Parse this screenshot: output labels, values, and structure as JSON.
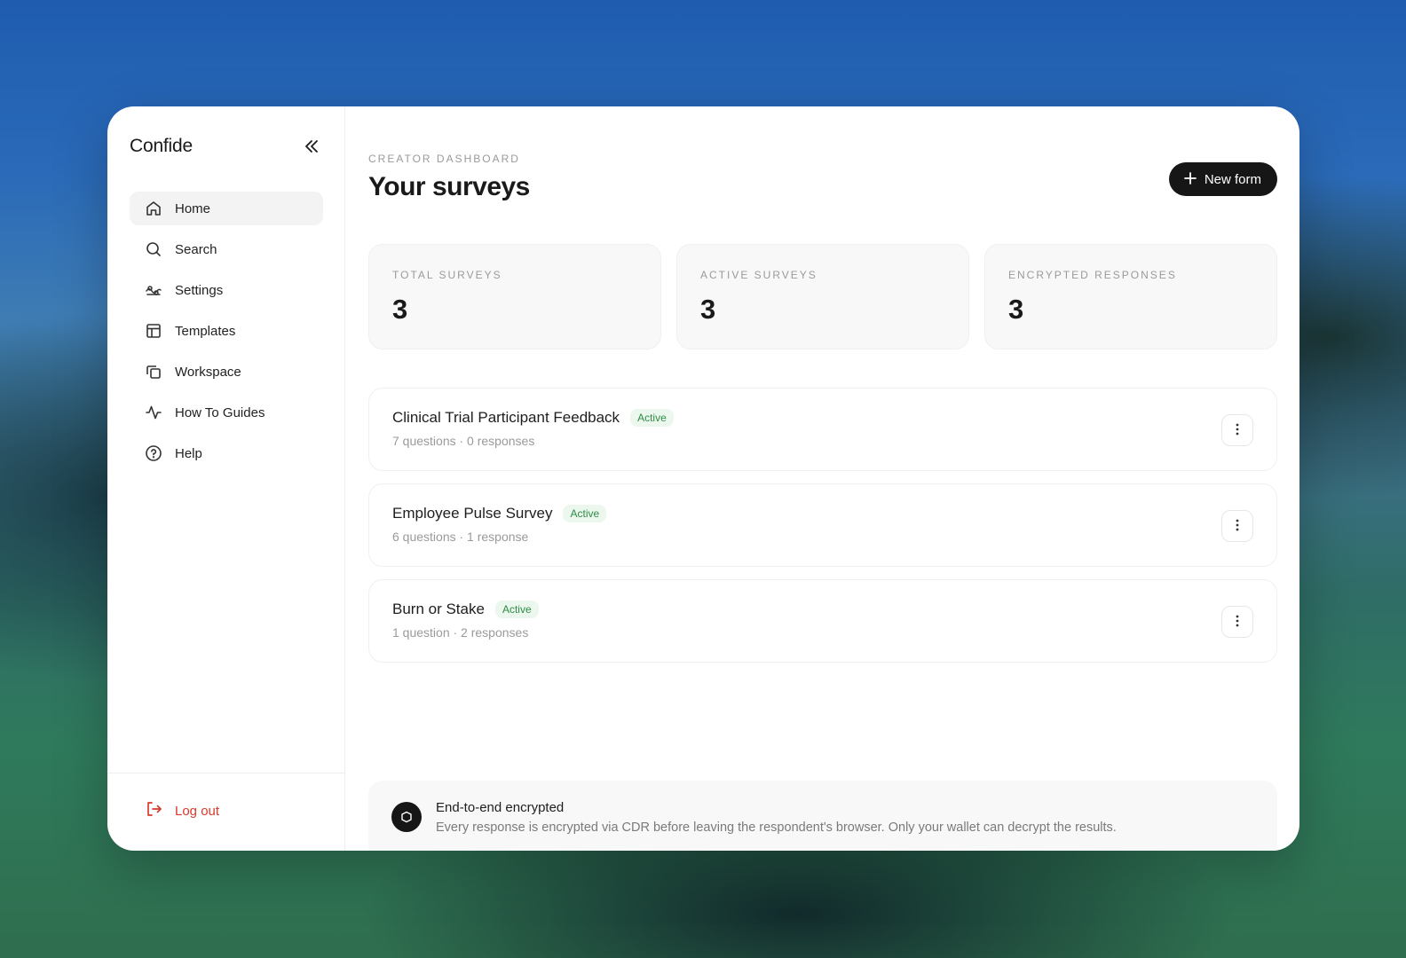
{
  "app": {
    "brand": "Confide"
  },
  "sidebar": {
    "items": [
      {
        "label": "Home",
        "icon": "home-icon",
        "active": true
      },
      {
        "label": "Search",
        "icon": "search-icon"
      },
      {
        "label": "Settings",
        "icon": "settings-icon"
      },
      {
        "label": "Templates",
        "icon": "templates-icon"
      },
      {
        "label": "Workspace",
        "icon": "workspace-icon"
      },
      {
        "label": "How To Guides",
        "icon": "activity-icon"
      },
      {
        "label": "Help",
        "icon": "help-icon"
      }
    ],
    "logout_label": "Log out"
  },
  "header": {
    "kicker": "CREATOR DASHBOARD",
    "title": "Your surveys",
    "new_form_label": "New form"
  },
  "stats": [
    {
      "label": "TOTAL SURVEYS",
      "value": "3"
    },
    {
      "label": "ACTIVE SURVEYS",
      "value": "3"
    },
    {
      "label": "ENCRYPTED RESPONSES",
      "value": "3"
    }
  ],
  "surveys": [
    {
      "name": "Clinical Trial Participant Feedback",
      "status": "Active",
      "meta": "7 questions · 0 responses"
    },
    {
      "name": "Employee Pulse Survey",
      "status": "Active",
      "meta": "6 questions · 1 response"
    },
    {
      "name": "Burn or Stake",
      "status": "Active",
      "meta": "1 question · 2 responses"
    }
  ],
  "encryption": {
    "title": "End-to-end encrypted",
    "description": "Every response is encrypted via CDR before leaving the respondent's browser. Only your wallet can decrypt the results."
  },
  "colors": {
    "accent": "#161616",
    "danger": "#d93a2b",
    "badge_bg": "#ecf8ee",
    "badge_text": "#2e8b45"
  }
}
